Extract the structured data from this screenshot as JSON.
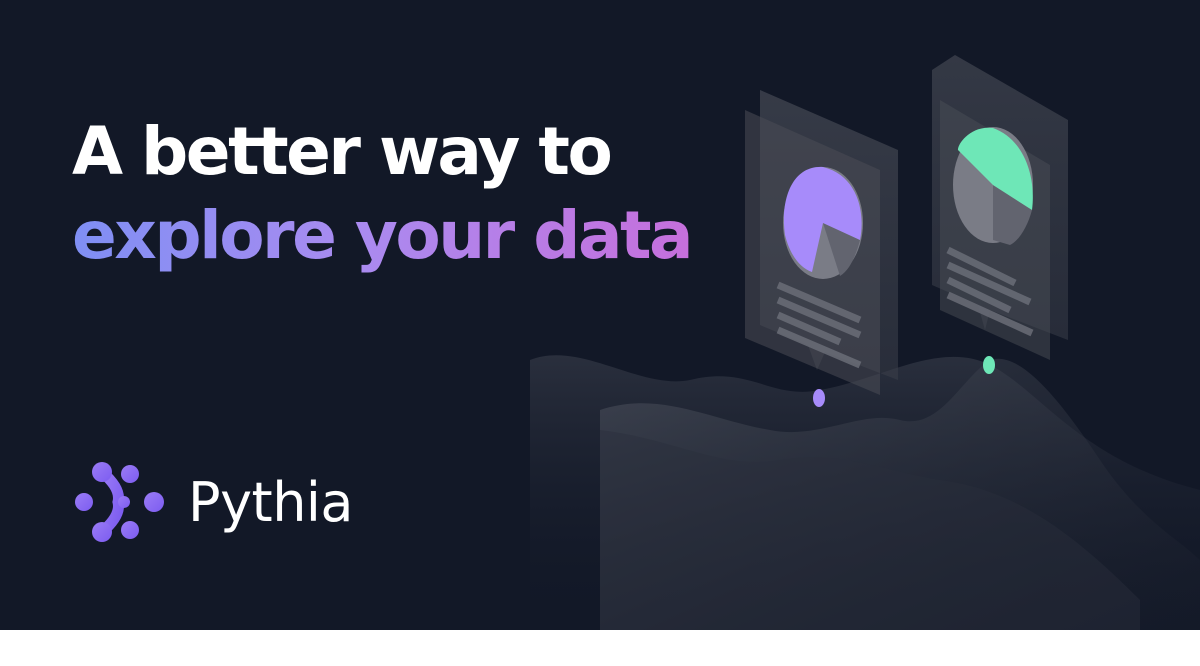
{
  "headline": {
    "line1": "A better way to",
    "line2": "explore your data"
  },
  "brand": {
    "name": "Pythia",
    "logo_icon": "pythia-dots-logo"
  },
  "colors": {
    "background": "#121827",
    "gradient_start": "#7f8ff4",
    "gradient_end": "#c66fdc",
    "purple_accent": "#a78bfa",
    "green_accent": "#6ee7b7"
  },
  "illustration": {
    "cards": [
      {
        "chart": "pie",
        "accent": "purple"
      },
      {
        "chart": "pie",
        "accent": "green"
      }
    ]
  }
}
